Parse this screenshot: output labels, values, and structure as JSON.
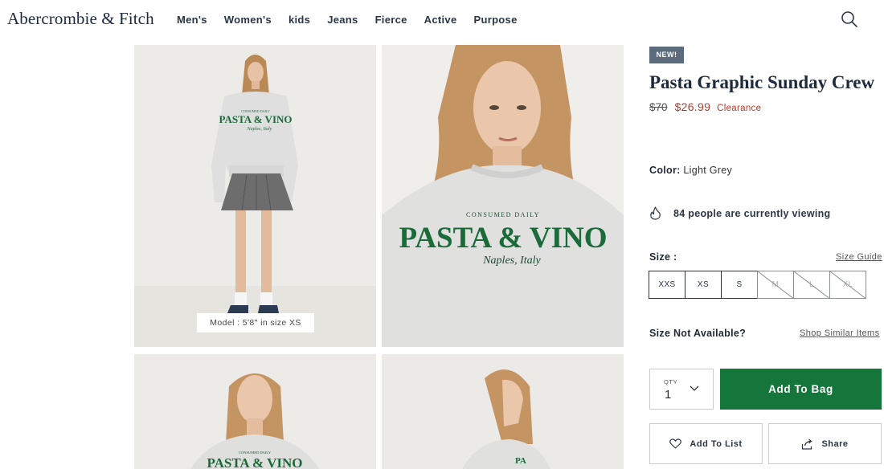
{
  "brand": {
    "logo_text": "Abercrombie & Fitch"
  },
  "nav": {
    "items": [
      {
        "label": "Men's",
        "name": "nav-item-mens"
      },
      {
        "label": "Women's",
        "name": "nav-item-womens"
      },
      {
        "label": "kids",
        "name": "nav-item-kids"
      },
      {
        "label": "Jeans",
        "name": "nav-item-jeans"
      },
      {
        "label": "Fierce",
        "name": "nav-item-fierce"
      },
      {
        "label": "Active",
        "name": "nav-item-active"
      },
      {
        "label": "Purpose",
        "name": "nav-item-purpose"
      }
    ],
    "search_icon": "search-icon"
  },
  "gallery": {
    "model_caption": "Model : 5'8\" in size XS",
    "print_small": "CONSUMED DAILY",
    "print_big": "PASTA & VINO",
    "print_script": "Naples, Italy"
  },
  "product": {
    "badge": "NEW!",
    "title": "Pasta Graphic Sunday Crew",
    "price_original": "$70",
    "price_sale": "$26.99",
    "price_tag": "Clearance",
    "color_label": "Color:",
    "color_value": "Light Grey",
    "viewing_text": "84 people are currently viewing",
    "size_label": "Size :",
    "size_guide": "Size Guide",
    "sizes": [
      {
        "label": "XXS",
        "available": true
      },
      {
        "label": "XS",
        "available": true
      },
      {
        "label": "S",
        "available": true
      },
      {
        "label": "M",
        "available": false
      },
      {
        "label": "L",
        "available": false
      },
      {
        "label": "XL",
        "available": false
      }
    ],
    "size_na_label": "Size Not Available?",
    "shop_similar": "Shop Similar Items",
    "qty_label": "QTY",
    "qty_value": "1",
    "add_to_bag": "Add To Bag",
    "add_to_list": "Add To List",
    "share": "Share"
  },
  "colors": {
    "navy_text": "#1c2a3c",
    "sale_red": "#b83a2b",
    "cta_green": "#14763a",
    "badge_slate": "#5b6b7c",
    "print_green": "#1b6b3a"
  }
}
